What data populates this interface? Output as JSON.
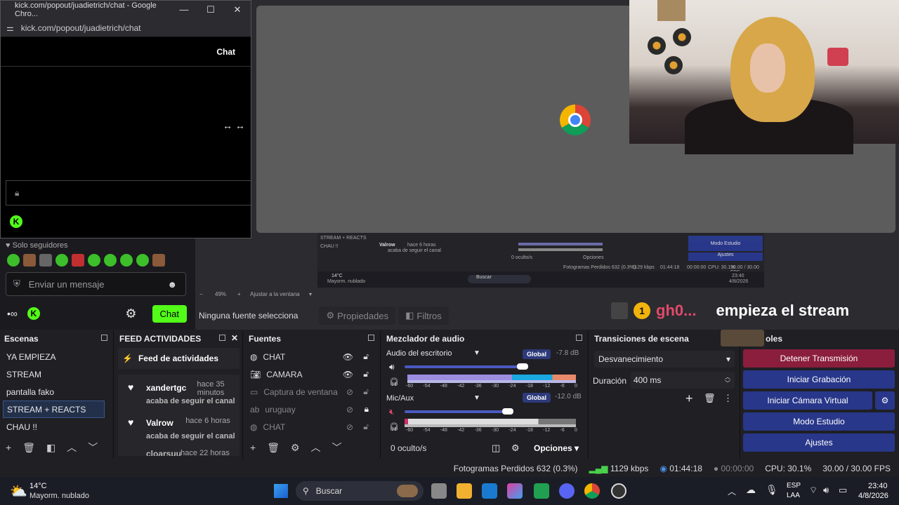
{
  "chat_window": {
    "title": "kick.com/popout/juadietrich/chat - Google Chro...",
    "url": "kick.com/popout/juadietrich/chat",
    "header": "Chat",
    "minimize": "—",
    "maximize": "☐",
    "close": "✕"
  },
  "dock_chat": {
    "followers_only": "Solo seguidores",
    "message_placeholder": "Enviar un mensaje",
    "send_label": "Chat"
  },
  "preview": {
    "zoom_value": "49%",
    "zoom_fit": "Ajustar a la ventana",
    "no_source": "Ninguna fuente selecciona",
    "properties": "Propiedades",
    "filters": "Filtros"
  },
  "overlay": {
    "count": "1",
    "username": "gh0...",
    "message": "empieza el stream"
  },
  "scenes": {
    "title": "Escenas",
    "items": [
      "YA EMPIEZA",
      "STREAM",
      "pantalla fako",
      "STREAM + REACTS",
      "CHAU !!"
    ],
    "selected_index": 3
  },
  "feed": {
    "title": "FEED ACTIVIDADES",
    "header": "Feed de actividades",
    "items": [
      {
        "name": "xandertgc",
        "time": "hace 35 minutos",
        "action": "acaba de seguir el canal"
      },
      {
        "name": "Valrow",
        "time": "hace 6 horas",
        "action": "acaba de seguir el canal"
      },
      {
        "name": "cloarsuu",
        "time": "hace 22 horas",
        "action": ""
      }
    ]
  },
  "sources": {
    "title": "Fuentes",
    "items": [
      {
        "label": "CHAT",
        "icon": "globe-icon",
        "visible": true,
        "locked": false
      },
      {
        "label": "CAMARA",
        "icon": "camera-icon",
        "visible": true,
        "locked": false
      },
      {
        "label": "Captura de ventana",
        "icon": "window-icon",
        "visible": false,
        "locked": false
      },
      {
        "label": "uruguay",
        "icon": "text-icon",
        "visible": false,
        "locked": true
      },
      {
        "label": "CHAT",
        "icon": "globe-icon",
        "visible": false,
        "locked": false
      }
    ]
  },
  "mixer": {
    "title": "Mezclador de audio",
    "tracks": [
      {
        "name": "Audio del escritorio",
        "global": "Global",
        "db": "-7.8 dB",
        "level": 0.93
      },
      {
        "name": "Mic/Aux",
        "global": "Global",
        "db": "-12.0 dB",
        "level": 0.8
      }
    ],
    "scale": [
      "-60",
      "-54",
      "-48",
      "-42",
      "-36",
      "-30",
      "-24",
      "-18",
      "-12",
      "-6",
      "0"
    ],
    "hidden": "0 oculto/s",
    "options": "Opciones"
  },
  "transitions": {
    "title": "Transiciones de escena",
    "selected": "Desvanecimiento",
    "duration_label": "Duración",
    "duration_value": "400 ms"
  },
  "controls": {
    "title": "oles",
    "buttons": [
      "Detener Transmisión",
      "Iniciar Grabación",
      "Iniciar Cámara Virtual",
      "Modo Estudio",
      "Ajustes"
    ]
  },
  "status": {
    "dropped": "Fotogramas Perdidos 632 (0.3%)",
    "bitrate": "1129 kbps",
    "live_time": "01:44:18",
    "rec_time": "00:00:00",
    "cpu": "CPU: 30.1%",
    "fps": "30.00 / 30.00 FPS"
  },
  "taskbar": {
    "weather_temp": "14°C",
    "weather_desc": "Mayorm. nublado",
    "search": "Buscar",
    "lang": "ESP",
    "lang_sub": "LAA",
    "time": "23:40",
    "date": "4/8/2026"
  },
  "nested": {
    "scene1": "STREAM + REACTS",
    "scene2": "CHAU !!",
    "feed_name": "Valrow",
    "feed_time": "hace 6 horas",
    "feed_action": "acaba de seguir el canal",
    "hidden": "0 oculto/s",
    "options": "Opciones",
    "dropped": "Fotogramas Perdidos 632 (0.3%)",
    "bitrate": "1129 kbps",
    "live": "01:44:18",
    "rec": "00:00:00",
    "cpu": "CPU: 30.1%",
    "fps": "30.00 / 30.00 FPS",
    "modo": "Modo Estudio",
    "ajustes": "Ajustes",
    "temp": "14°C",
    "weather": "Mayorm. nublado",
    "search": "Buscar",
    "time": "23:40",
    "date": "4/8/2026"
  }
}
